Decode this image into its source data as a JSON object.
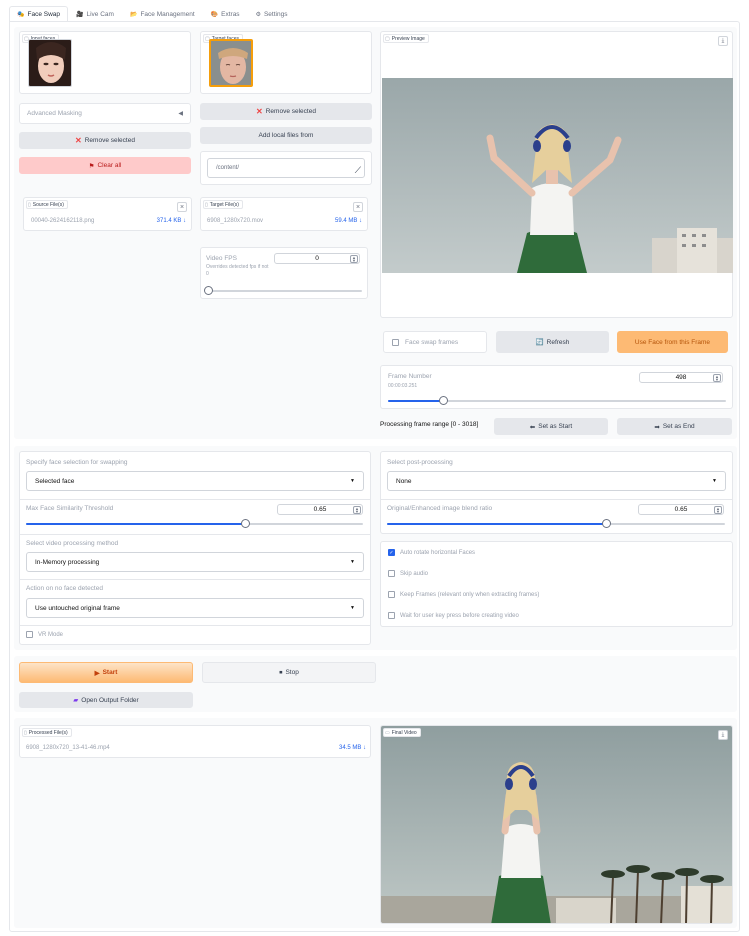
{
  "tabs": [
    {
      "icon": "🎭",
      "label": "Face Swap"
    },
    {
      "icon": "🎥",
      "label": "Live Cam"
    },
    {
      "icon": "📂",
      "label": "Face Management"
    },
    {
      "icon": "🎨",
      "label": "Extras"
    },
    {
      "icon": "⚙",
      "label": "Settings"
    }
  ],
  "input_faces": {
    "label": "Input faces"
  },
  "target_faces": {
    "label": "Target faces"
  },
  "preview": {
    "label": "Preview Image"
  },
  "advanced_masking": {
    "label": "Advanced Masking"
  },
  "left_buttons": {
    "remove_selected": "Remove selected",
    "clear_all": "Clear all"
  },
  "target_buttons": {
    "remove_selected": "Remove selected",
    "add_local": "Add local files from"
  },
  "path_input": {
    "value": "/content/"
  },
  "source_files": {
    "label": "Source File(s)",
    "name": "00040-2624162118.png",
    "size": "371.4 KB ↓"
  },
  "target_files": {
    "label": "Target File(s)",
    "name": "6908_1280x720.mov",
    "size": "59.4 MB ↓"
  },
  "video_fps": {
    "label": "Video FPS",
    "info": "Overrides detected fps if not 0",
    "value": "0",
    "slider_fraction": 0
  },
  "preview_controls": {
    "face_swap_frames": "Face swap frames",
    "refresh": "Refresh",
    "use_face": "Use Face from this Frame"
  },
  "frame_number": {
    "label": "Frame Number",
    "time": "00:00:03.251",
    "value": "498",
    "slider_fraction": 0.165
  },
  "processing_range": {
    "label": "Processing frame range [0 - 3018]",
    "set_start": "Set as Start",
    "set_end": "Set as End"
  },
  "face_selection": {
    "label": "Specify face selection for swapping",
    "value": "Selected face"
  },
  "similarity": {
    "label": "Max Face Similarity Threshold",
    "value": "0.65",
    "slider_fraction": 0.65
  },
  "video_method": {
    "label": "Select video processing method",
    "value": "In-Memory processing"
  },
  "no_face": {
    "label": "Action on no face detected",
    "value": "Use untouched original frame"
  },
  "vr_mode": {
    "label": "VR Mode",
    "checked": false
  },
  "post_processing": {
    "label": "Select post-processing",
    "value": "None"
  },
  "blend_ratio": {
    "label": "Original/Enhanced image blend ratio",
    "value": "0.65",
    "slider_fraction": 0.65
  },
  "options": [
    {
      "label": "Auto rotate horizontal Faces",
      "checked": true
    },
    {
      "label": "Skip audio",
      "checked": false
    },
    {
      "label": "Keep Frames (relevant only when extracting frames)",
      "checked": false
    },
    {
      "label": "Wait for user key press before creating video",
      "checked": false
    }
  ],
  "actions": {
    "start": "Start",
    "stop": "Stop",
    "open_output": "Open Output Folder"
  },
  "processed_files": {
    "label": "Processed File(s)",
    "name": "6908_1280x720_13-41-46.mp4",
    "size": "34.5 MB ↓"
  },
  "final_video": {
    "label": "Final Video"
  },
  "colors": {
    "accent": "#2563eb",
    "orange": "#fdba74",
    "pink": "#fecaca"
  }
}
